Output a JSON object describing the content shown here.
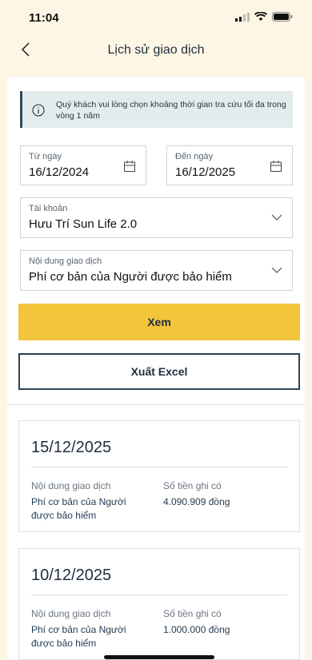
{
  "status_bar": {
    "time": "11:04"
  },
  "nav": {
    "title": "Lịch sử giao dịch"
  },
  "notice": {
    "text": "Quý khách vui lòng chọn khoảng thời gian tra cứu tối đa trong vòng 1 năm"
  },
  "filters": {
    "from": {
      "label": "Từ ngày",
      "value": "16/12/2024"
    },
    "to": {
      "label": "Đến ngày",
      "value": "16/12/2025"
    },
    "account": {
      "label": "Tài khoản",
      "value": "Hưu Trí Sun Life 2.0"
    },
    "content": {
      "label": "Nội dung giao dịch",
      "value": "Phí cơ bản của Người được bảo hiểm"
    }
  },
  "buttons": {
    "view": "Xem",
    "export": "Xuất Excel"
  },
  "transactions": [
    {
      "date": "15/12/2025",
      "content_label": "Nội dung giao dịch",
      "content": "Phí cơ bản của Người được bảo hiểm",
      "amount_label": "Số tiền ghi có",
      "amount": "4.090.909 đồng"
    },
    {
      "date": "10/12/2025",
      "content_label": "Nội dung giao dịch",
      "content": "Phí cơ bản của Người được bảo hiểm",
      "amount_label": "Số tiền ghi có",
      "amount": "1.000.000 đồng"
    }
  ],
  "colors": {
    "background": "#fdf6e4",
    "accent": "#f2c53a",
    "navy": "#1f2d3d"
  }
}
